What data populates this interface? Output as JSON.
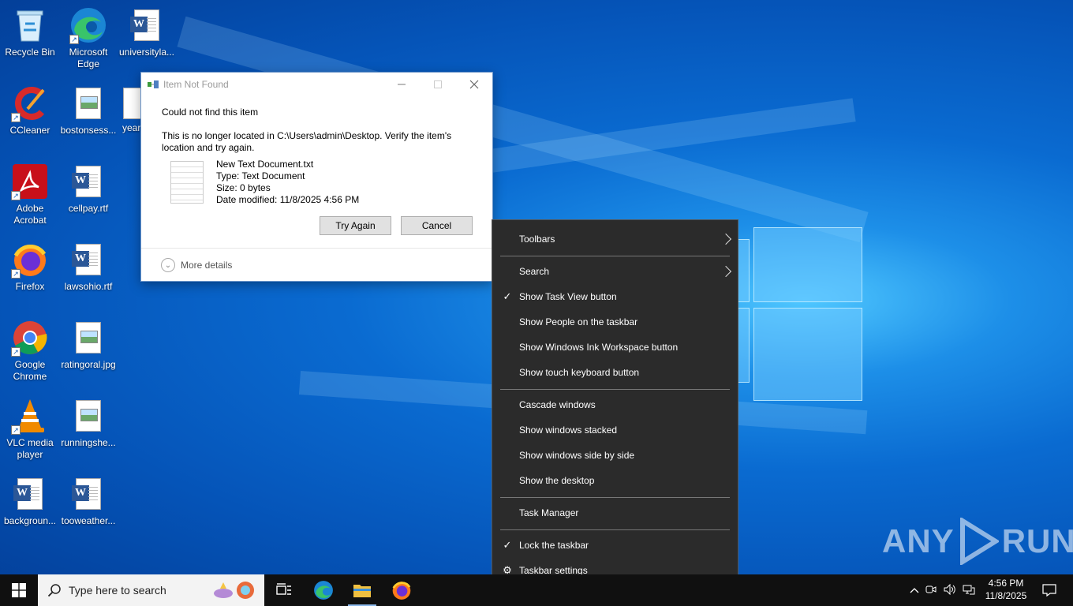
{
  "desktop": {
    "icons": [
      {
        "label": "Recycle Bin",
        "icon": "recycle-bin-icon"
      },
      {
        "label": "Microsoft Edge",
        "icon": "edge-icon"
      },
      {
        "label": "universityla...",
        "icon": "word-doc-icon"
      },
      {
        "label": "CCleaner",
        "icon": "ccleaner-icon"
      },
      {
        "label": "bostonsess...",
        "icon": "image-file-icon"
      },
      {
        "label": "year",
        "icon": "image-file-icon"
      },
      {
        "label": "Adobe Acrobat",
        "icon": "acrobat-icon"
      },
      {
        "label": "cellpay.rtf",
        "icon": "word-doc-icon"
      },
      {
        "label": "Firefox",
        "icon": "firefox-icon"
      },
      {
        "label": "lawsohio.rtf",
        "icon": "word-doc-icon"
      },
      {
        "label": "Google Chrome",
        "icon": "chrome-icon"
      },
      {
        "label": "ratingoral.jpg",
        "icon": "image-file-icon"
      },
      {
        "label": "VLC media player",
        "icon": "vlc-icon"
      },
      {
        "label": "runningshe...",
        "icon": "image-file-icon"
      },
      {
        "label": "backgroun...",
        "icon": "word-doc-icon"
      },
      {
        "label": "tooweather...",
        "icon": "word-doc-icon"
      }
    ]
  },
  "dialog": {
    "title": "Item Not Found",
    "heading": "Could not find this item",
    "message": "This is no longer located in C:\\Users\\admin\\Desktop. Verify the item's location and try again.",
    "file": {
      "name": "New Text Document.txt",
      "type": "Type: Text Document",
      "size": "Size: 0 bytes",
      "modified": "Date modified: 11/8/2025 4:56 PM"
    },
    "try_again_label": "Try Again",
    "cancel_label": "Cancel",
    "more_details_label": "More details"
  },
  "context_menu": {
    "toolbars": "Toolbars",
    "search": "Search",
    "show_task_view": "Show Task View button",
    "show_people": "Show People on the taskbar",
    "show_ink": "Show Windows Ink Workspace button",
    "show_touch_kb": "Show touch keyboard button",
    "cascade": "Cascade windows",
    "stacked": "Show windows stacked",
    "side_by_side": "Show windows side by side",
    "show_desktop": "Show the desktop",
    "task_manager": "Task Manager",
    "lock_taskbar": "Lock the taskbar",
    "taskbar_settings": "Taskbar settings"
  },
  "taskbar": {
    "search_placeholder": "Type here to search",
    "time": "4:56 PM",
    "date": "11/8/2025"
  },
  "watermark": {
    "left": "ANY",
    "right": "RUN"
  }
}
